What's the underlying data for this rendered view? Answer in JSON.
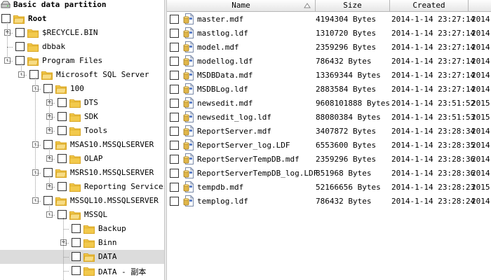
{
  "tree": {
    "partition_label": "Basic data partition",
    "nodes": [
      {
        "label": "Root",
        "bold": true
      },
      {
        "label": "$RECYCLE.BIN"
      },
      {
        "label": "dbbak"
      },
      {
        "label": "Program Files"
      },
      {
        "label": "Microsoft SQL Server"
      },
      {
        "label": "100"
      },
      {
        "label": "DTS"
      },
      {
        "label": "SDK"
      },
      {
        "label": "Tools"
      },
      {
        "label": "MSAS10.MSSQLSERVER"
      },
      {
        "label": "OLAP"
      },
      {
        "label": "MSRS10.MSSQLSERVER"
      },
      {
        "label": "Reporting Services"
      },
      {
        "label": "MSSQL10.MSSQLSERVER"
      },
      {
        "label": "MSSQL"
      },
      {
        "label": "Backup"
      },
      {
        "label": "Binn"
      },
      {
        "label": "DATA"
      },
      {
        "label": "DATA - 副本"
      }
    ]
  },
  "list": {
    "columns": {
      "name": "Name",
      "size": "Size",
      "created": "Created"
    },
    "rows": [
      {
        "name": "master.mdf",
        "size": "4194304 Bytes",
        "created": "2014-1-14 23:27:14",
        "modified": "2014-"
      },
      {
        "name": "mastlog.ldf",
        "size": "1310720 Bytes",
        "created": "2014-1-14 23:27:14",
        "modified": "2014-"
      },
      {
        "name": "model.mdf",
        "size": "2359296 Bytes",
        "created": "2014-1-14 23:27:14",
        "modified": "2014-"
      },
      {
        "name": "modellog.ldf",
        "size": "786432 Bytes",
        "created": "2014-1-14 23:27:14",
        "modified": "2014-"
      },
      {
        "name": "MSDBData.mdf",
        "size": "13369344 Bytes",
        "created": "2014-1-14 23:27:14",
        "modified": "2014-"
      },
      {
        "name": "MSDBLog.ldf",
        "size": "2883584 Bytes",
        "created": "2014-1-14 23:27:14",
        "modified": "2014-"
      },
      {
        "name": "newsedit.mdf",
        "size": "9608101888 Bytes",
        "created": "2014-1-14 23:51:52",
        "modified": "2015-"
      },
      {
        "name": "newsedit_log.ldf",
        "size": "88080384 Bytes",
        "created": "2014-1-14 23:51:53",
        "modified": "2015-"
      },
      {
        "name": "ReportServer.mdf",
        "size": "3407872 Bytes",
        "created": "2014-1-14 23:28:34",
        "modified": "2014-"
      },
      {
        "name": "ReportServer_log.LDF",
        "size": "6553600 Bytes",
        "created": "2014-1-14 23:28:35",
        "modified": "2014-"
      },
      {
        "name": "ReportServerTempDB.mdf",
        "size": "2359296 Bytes",
        "created": "2014-1-14 23:28:36",
        "modified": "2014-"
      },
      {
        "name": "ReportServerTempDB_log.LDF",
        "size": "851968 Bytes",
        "created": "2014-1-14 23:28:36",
        "modified": "2014-"
      },
      {
        "name": "tempdb.mdf",
        "size": "52166656 Bytes",
        "created": "2014-1-14 23:28:23",
        "modified": "2015-"
      },
      {
        "name": "templog.ldf",
        "size": "786432 Bytes",
        "created": "2014-1-14 23:28:24",
        "modified": "2014-"
      }
    ]
  },
  "colors": {
    "folder": "#f2c94c",
    "folder_dark": "#d9a520",
    "selected_row": "#dcdcdc",
    "file_icon_blue": "#5b7fc9",
    "file_icon_gold": "#e0b64a"
  },
  "icons": {
    "partition": "drive-icon",
    "folder": "folder-icon",
    "file": "database-file-icon",
    "sort": "sort-up-icon"
  }
}
